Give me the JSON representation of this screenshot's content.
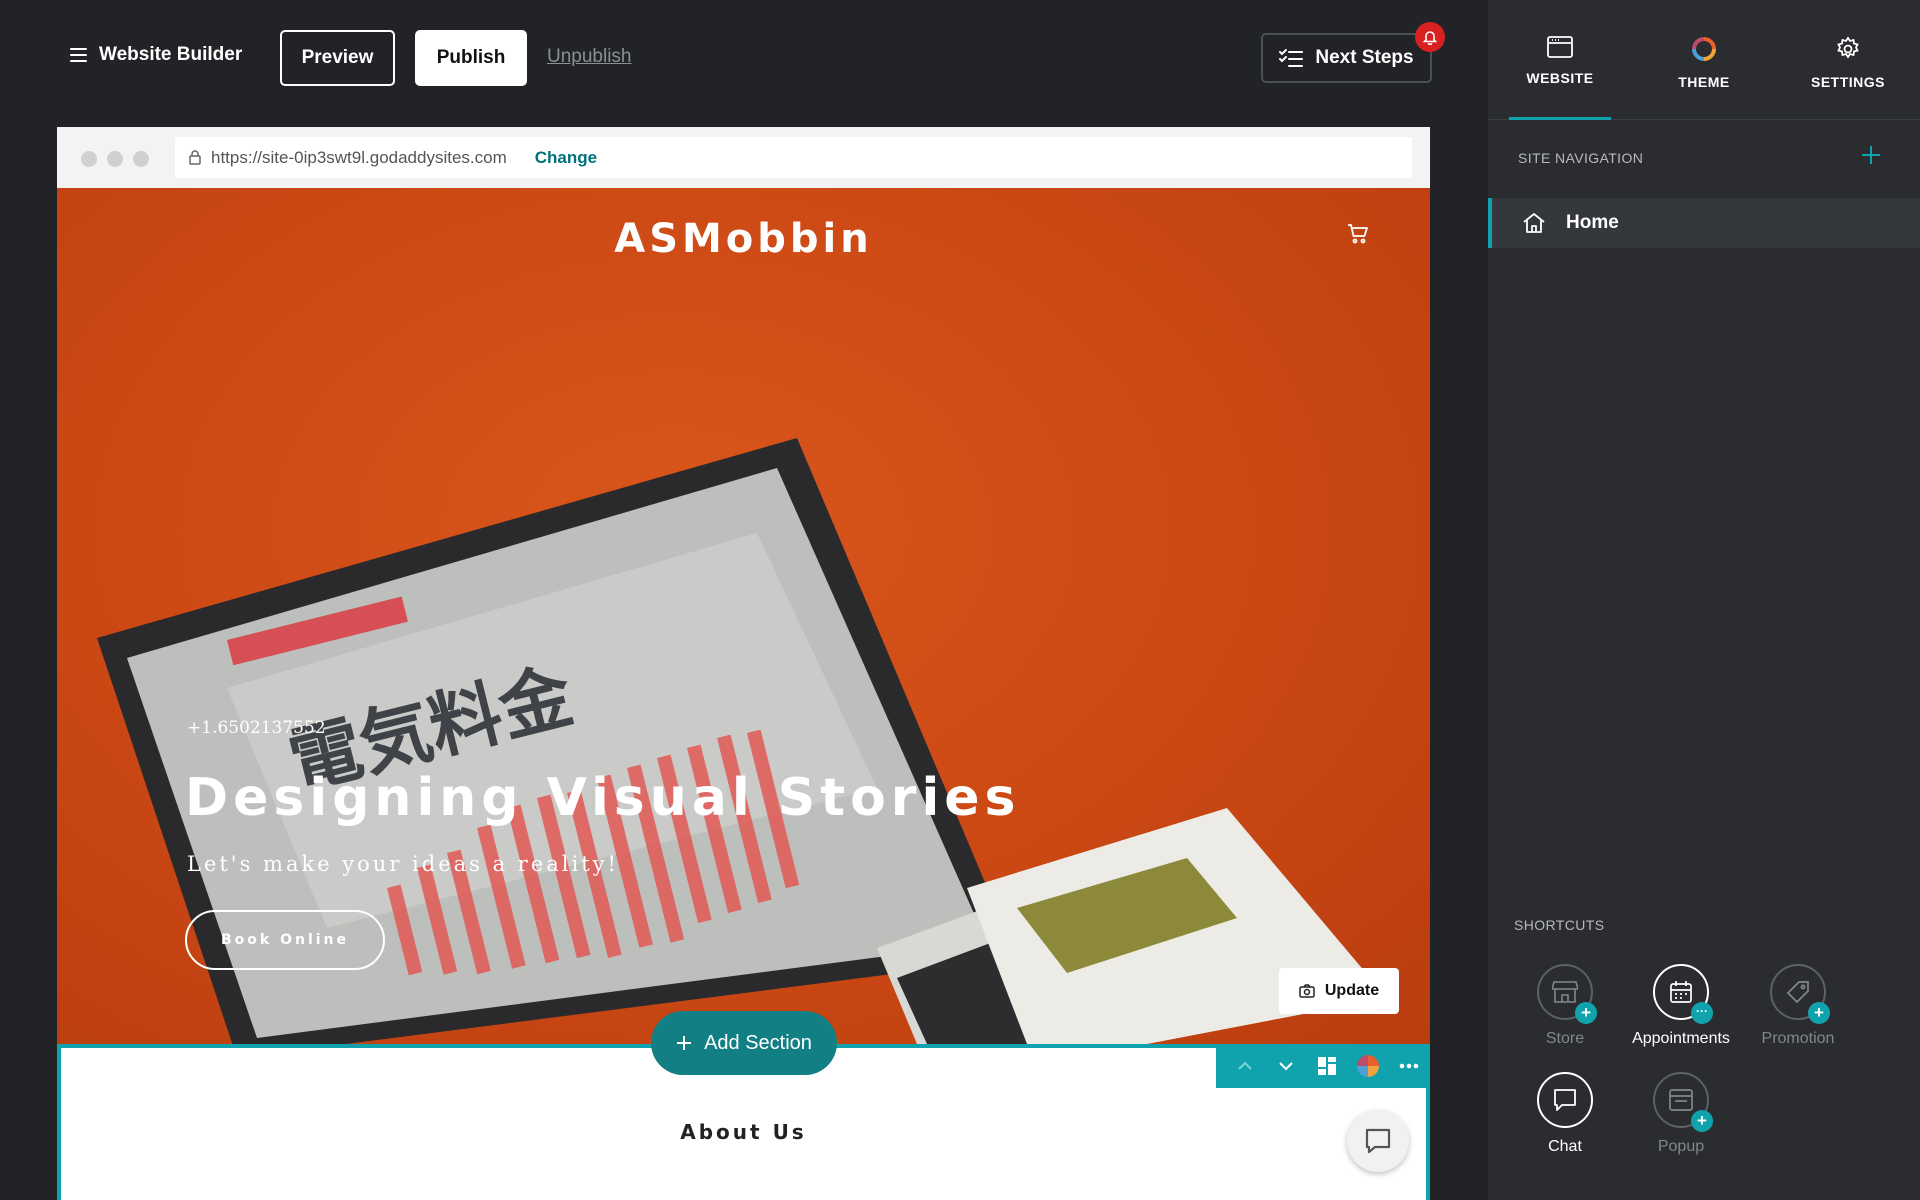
{
  "topbar": {
    "brand": "Website Builder",
    "preview": "Preview",
    "publish": "Publish",
    "unpublish": "Unpublish",
    "next_steps": "Next Steps"
  },
  "browser": {
    "url": "https://site-0ip3swt9l.godaddysites.com",
    "change": "Change"
  },
  "site": {
    "title": "ASMobbin",
    "phone": "+1.6502137552",
    "headline": "Designing Visual Stories",
    "tagline": "Let's make your ideas a reality!",
    "book_button": "Book Online",
    "update_button": "Update",
    "add_section": "Add Section",
    "about_title": "About Us",
    "hero_image_text": "電気料金"
  },
  "panel": {
    "tabs": [
      {
        "label": "WEBSITE",
        "icon": "browser-window-icon",
        "active": true
      },
      {
        "label": "THEME",
        "icon": "theme-ring-icon",
        "active": false
      },
      {
        "label": "SETTINGS",
        "icon": "gear-icon",
        "active": false
      }
    ],
    "nav_heading": "SITE NAVIGATION",
    "nav_items": [
      {
        "label": "Home",
        "icon": "home-icon"
      }
    ],
    "shortcuts_heading": "SHORTCUTS",
    "shortcuts": [
      {
        "label": "Store",
        "icon": "store-icon",
        "state": "add"
      },
      {
        "label": "Appointments",
        "icon": "calendar-icon",
        "state": "more"
      },
      {
        "label": "Promotion",
        "icon": "tag-icon",
        "state": "add"
      },
      {
        "label": "Chat",
        "icon": "chat-icon",
        "state": "active"
      },
      {
        "label": "Popup",
        "icon": "popup-window-icon",
        "state": "add"
      }
    ]
  },
  "colors": {
    "background": "#212327",
    "panel": "#2a2c30",
    "accent": "#11a3ad",
    "add_section": "#117f84",
    "hero": "#cb4814",
    "notification": "#d92121"
  }
}
